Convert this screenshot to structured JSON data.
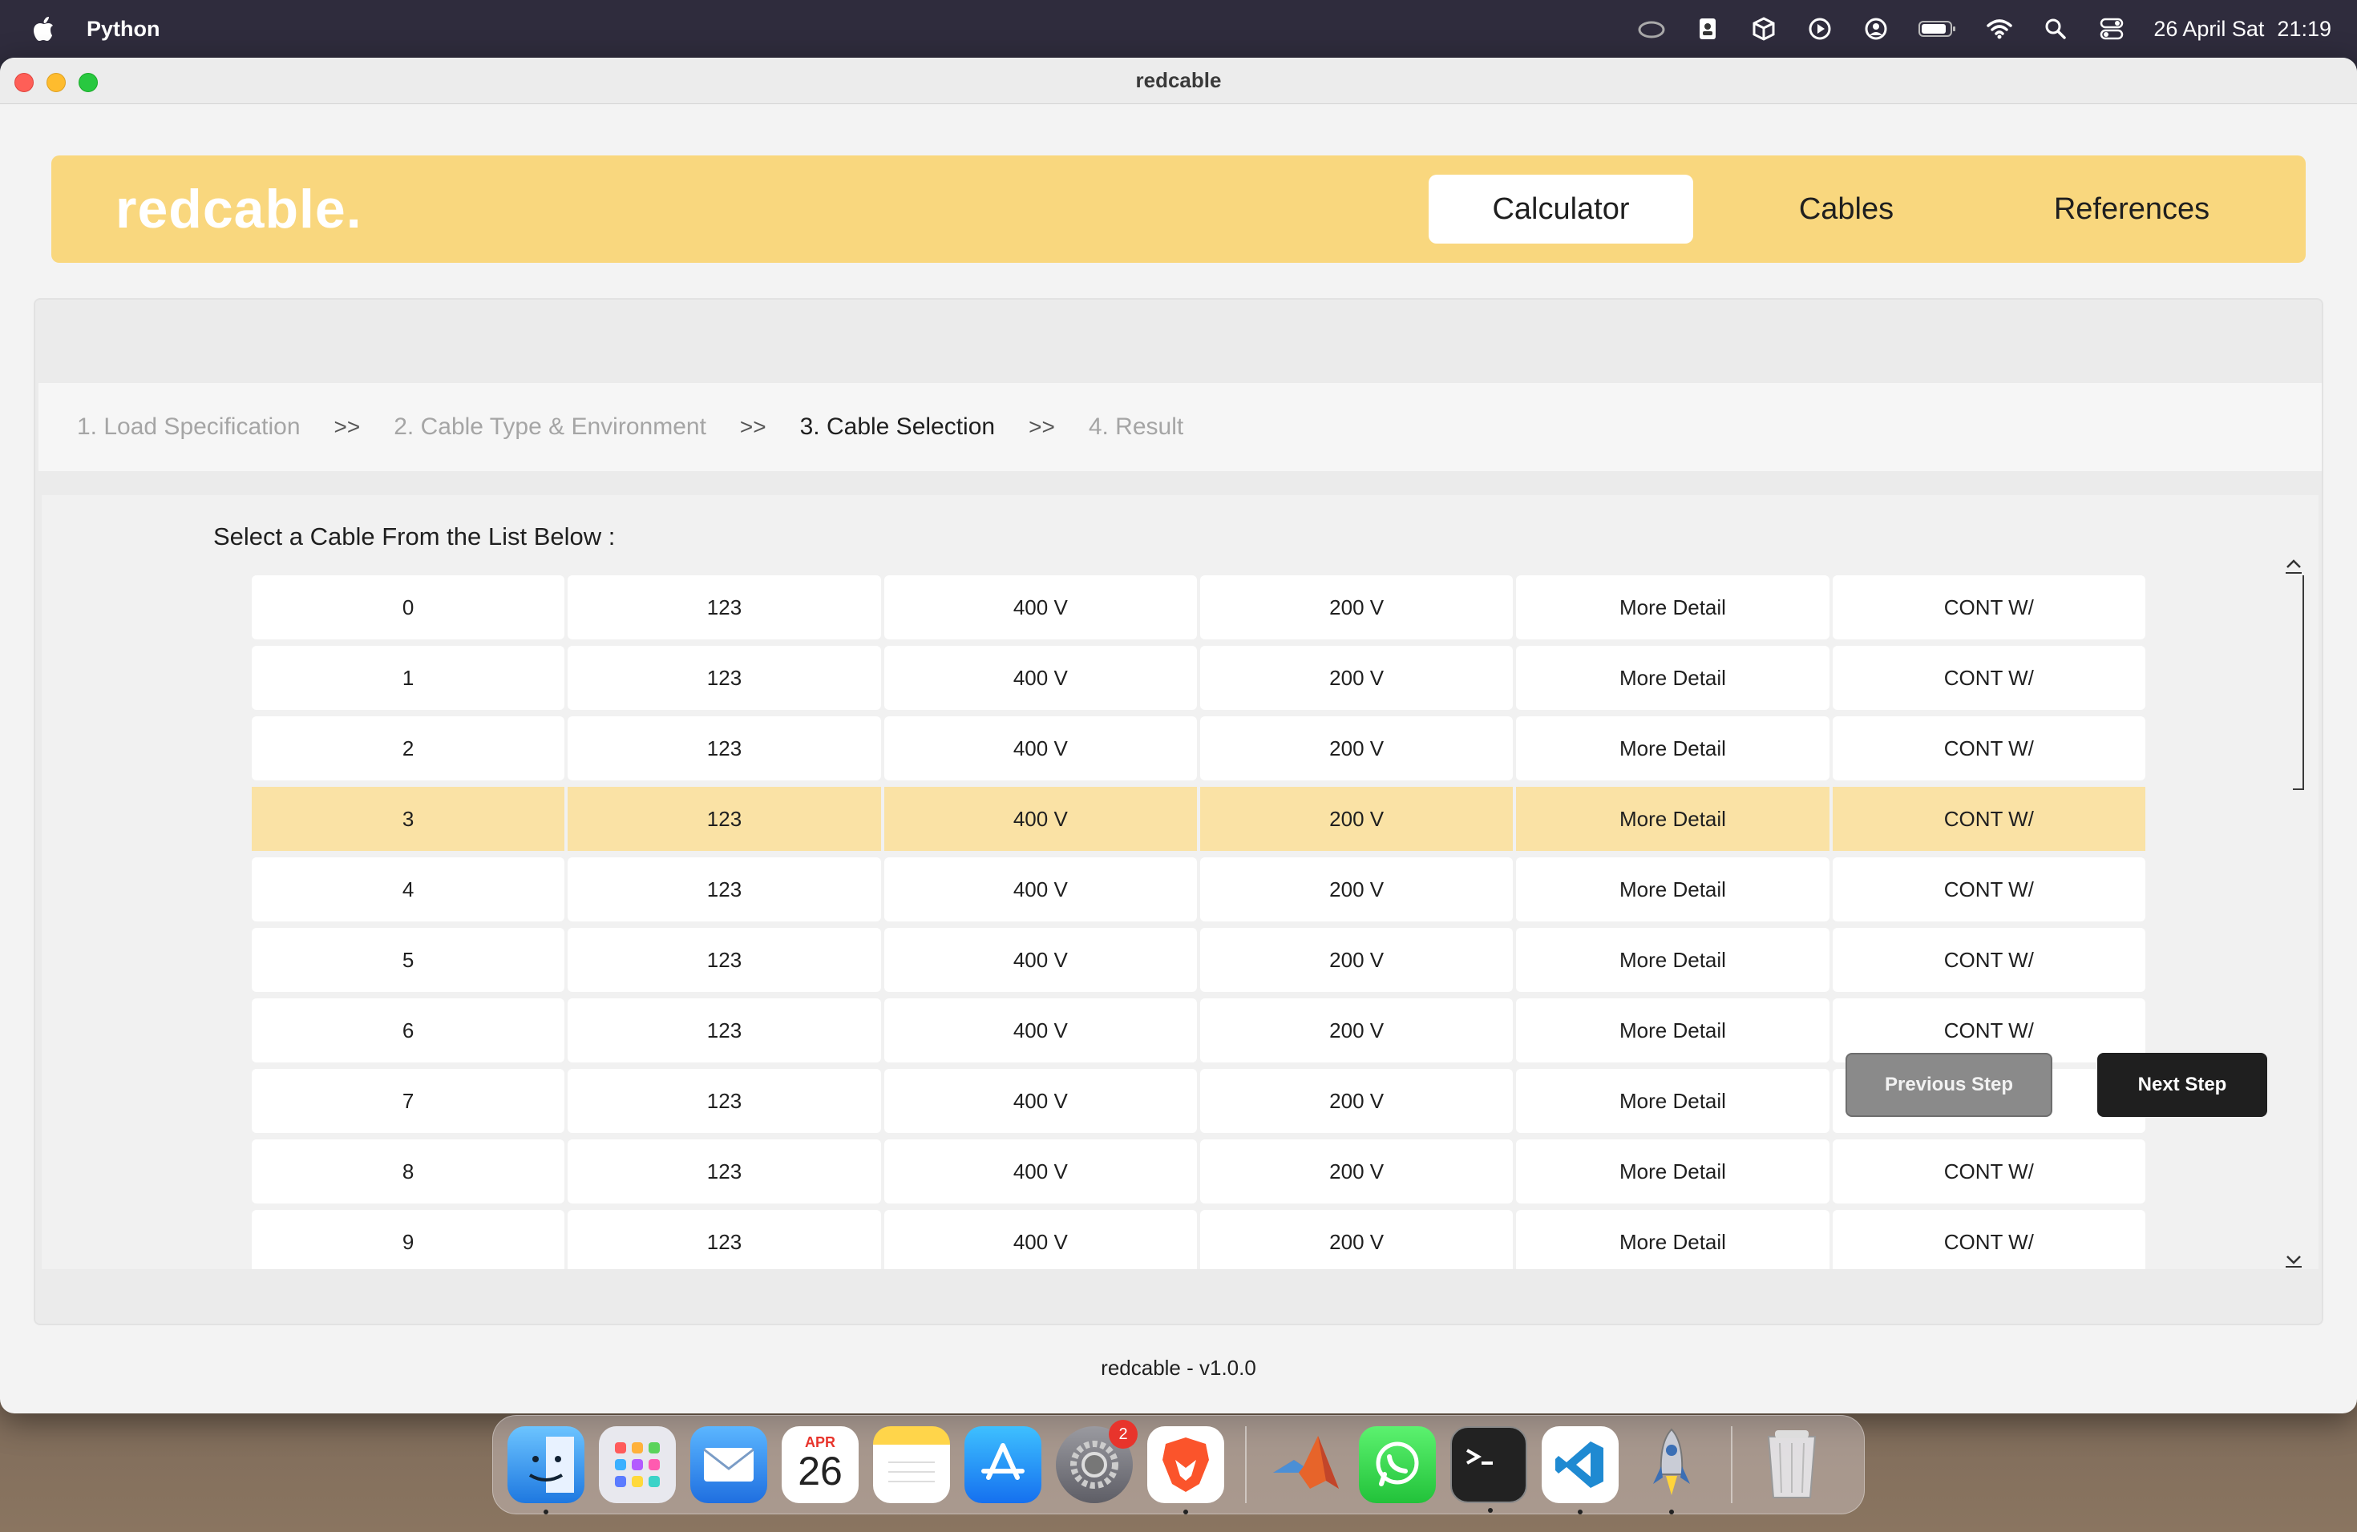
{
  "menubar": {
    "app_name": "Python",
    "date": "26 April Sat",
    "time": "21:19"
  },
  "window": {
    "title": "redcable"
  },
  "header": {
    "brand": "redcable.",
    "nav": [
      "Calculator",
      "Cables",
      "References"
    ],
    "active_nav": "Calculator"
  },
  "steps": {
    "items": [
      "1. Load Specification",
      "2. Cable Type & Environment",
      "3. Cable Selection",
      "4. Result"
    ],
    "separator": ">>",
    "current_index": 2
  },
  "cable_list": {
    "prompt": "Select a Cable From the List Below :",
    "selected_index": 3,
    "rows": [
      [
        "0",
        "123",
        "400 V",
        "200 V",
        "More Detail",
        "CONT W/"
      ],
      [
        "1",
        "123",
        "400 V",
        "200 V",
        "More Detail",
        "CONT W/"
      ],
      [
        "2",
        "123",
        "400 V",
        "200 V",
        "More Detail",
        "CONT W/"
      ],
      [
        "3",
        "123",
        "400 V",
        "200 V",
        "More Detail",
        "CONT W/"
      ],
      [
        "4",
        "123",
        "400 V",
        "200 V",
        "More Detail",
        "CONT W/"
      ],
      [
        "5",
        "123",
        "400 V",
        "200 V",
        "More Detail",
        "CONT W/"
      ],
      [
        "6",
        "123",
        "400 V",
        "200 V",
        "More Detail",
        "CONT W/"
      ],
      [
        "7",
        "123",
        "400 V",
        "200 V",
        "More Detail",
        "CONT W/"
      ],
      [
        "8",
        "123",
        "400 V",
        "200 V",
        "More Detail",
        "CONT W/"
      ],
      [
        "9",
        "123",
        "400 V",
        "200 V",
        "More Detail",
        "CONT W/"
      ]
    ]
  },
  "buttons": {
    "previous": "Previous Step",
    "next": "Next Step"
  },
  "footer": {
    "version_text": "redcable - v1.0.0"
  },
  "dock": {
    "calendar_month": "APR",
    "calendar_day": "26",
    "settings_badge": "2",
    "apps": [
      "finder-icon",
      "launchpad-icon",
      "mail-icon",
      "calendar-icon",
      "notes-icon",
      "app-store-icon",
      "system-settings-icon",
      "brave-browser-icon",
      "matlab-icon",
      "whatsapp-icon",
      "terminal-icon",
      "vscode-icon",
      "python-rocket-icon",
      "trash-icon"
    ]
  },
  "colors": {
    "accent": "#f9d77e",
    "selected_row": "#fae2a5",
    "next_button": "#1f1f1f",
    "previous_button": "#8a8a8a"
  }
}
